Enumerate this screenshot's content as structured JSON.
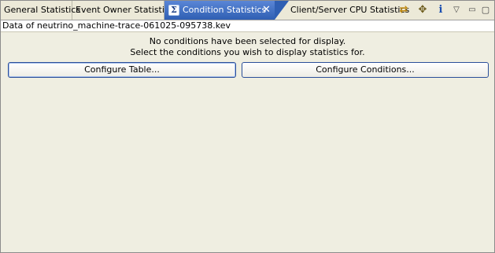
{
  "tabs": [
    {
      "label": "General Statistics",
      "active": false
    },
    {
      "label": "Event Owner Statistics",
      "active": false
    },
    {
      "label": "Condition Statistics",
      "active": true,
      "icon": "sigma-icon",
      "icon_glyph": "Σ",
      "close_glyph": "✕"
    },
    {
      "label": "Client/Server CPU Statistics",
      "active": false
    }
  ],
  "toolbar": {
    "sync_icon": "⇄",
    "filter_icon": "✥",
    "info_icon": "i",
    "menu_icon": "▽",
    "minimize_icon": "▭",
    "maximize_icon": "▢"
  },
  "header": {
    "data_source": "Data of neutrino_machine-trace-061025-095738.kev"
  },
  "main": {
    "message_line1": "No conditions have been selected for display.",
    "message_line2": "Select the conditions you wish to display statistics for.",
    "configure_table_label": "Configure Table...",
    "configure_conditions_label": "Configure Conditions..."
  },
  "colors": {
    "active_tab": "#3f6fc0",
    "panel_background": "#efeee1",
    "button_border": "#2a4e99"
  }
}
